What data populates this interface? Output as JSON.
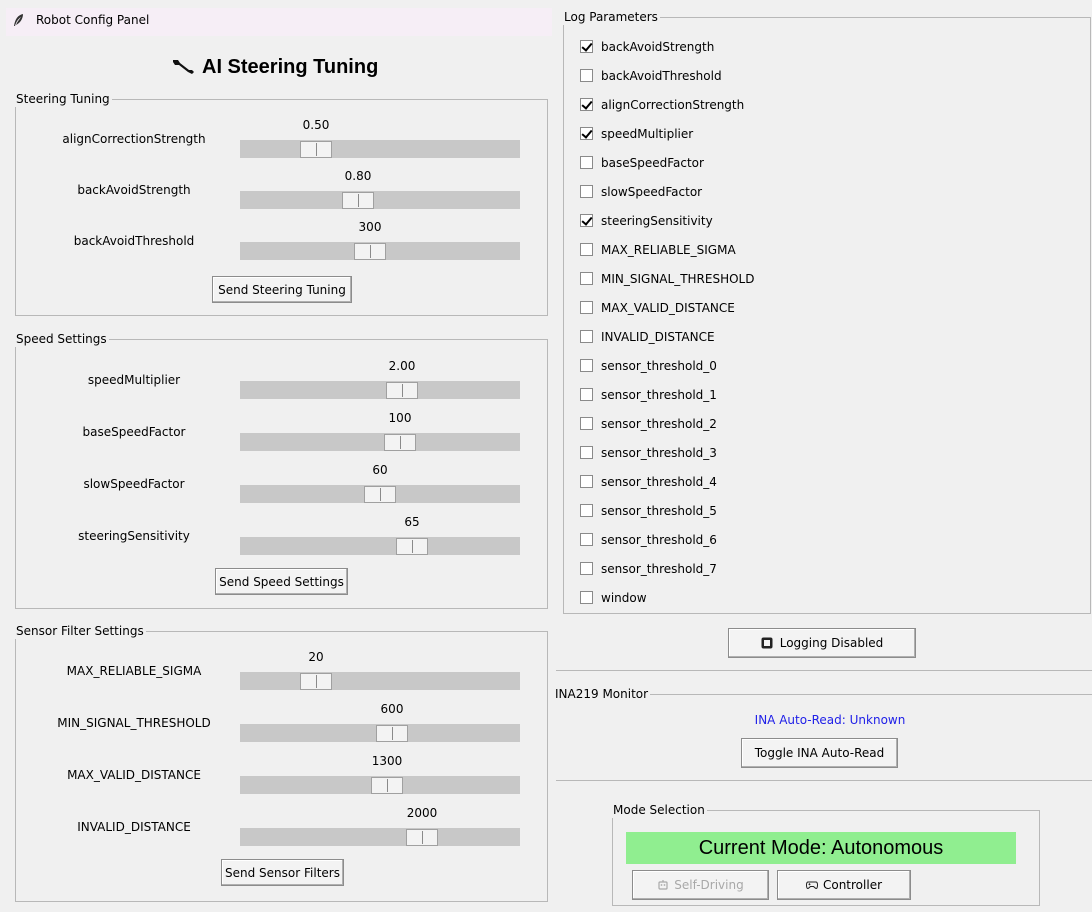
{
  "window": {
    "title": "Robot Config Panel"
  },
  "heading": "AI Steering Tuning",
  "steering": {
    "title": "Steering Tuning",
    "sliders": [
      {
        "label": "alignCorrectionStrength",
        "value": "0.50",
        "position": 0.24
      },
      {
        "label": "backAvoidStrength",
        "value": "0.80",
        "position": 0.41
      },
      {
        "label": "backAvoidThreshold",
        "value": "300",
        "position": 0.46
      }
    ],
    "button": "Send Steering Tuning"
  },
  "speed": {
    "title": "Speed Settings",
    "sliders": [
      {
        "label": "speedMultiplier",
        "value": "2.00",
        "position": 0.59
      },
      {
        "label": "baseSpeedFactor",
        "value": "100",
        "position": 0.58
      },
      {
        "label": "slowSpeedFactor",
        "value": "60",
        "position": 0.5
      },
      {
        "label": "steeringSensitivity",
        "value": "65",
        "position": 0.63
      }
    ],
    "button": "Send Speed Settings"
  },
  "sensor": {
    "title": "Sensor Filter Settings",
    "sliders": [
      {
        "label": "MAX_RELIABLE_SIGMA",
        "value": "20",
        "position": 0.24
      },
      {
        "label": "MIN_SIGNAL_THRESHOLD",
        "value": "600",
        "position": 0.55
      },
      {
        "label": "MAX_VALID_DISTANCE",
        "value": "1300",
        "position": 0.53
      },
      {
        "label": "INVALID_DISTANCE",
        "value": "2000",
        "position": 0.67
      }
    ],
    "button": "Send Sensor Filters"
  },
  "log": {
    "title": "Log Parameters",
    "params": [
      {
        "label": "backAvoidStrength",
        "checked": true
      },
      {
        "label": "backAvoidThreshold",
        "checked": false
      },
      {
        "label": "alignCorrectionStrength",
        "checked": true
      },
      {
        "label": "speedMultiplier",
        "checked": true
      },
      {
        "label": "baseSpeedFactor",
        "checked": false
      },
      {
        "label": "slowSpeedFactor",
        "checked": false
      },
      {
        "label": "steeringSensitivity",
        "checked": true
      },
      {
        "label": "MAX_RELIABLE_SIGMA",
        "checked": false
      },
      {
        "label": "MIN_SIGNAL_THRESHOLD",
        "checked": false
      },
      {
        "label": "MAX_VALID_DISTANCE",
        "checked": false
      },
      {
        "label": "INVALID_DISTANCE",
        "checked": false
      },
      {
        "label": "sensor_threshold_0",
        "checked": false
      },
      {
        "label": "sensor_threshold_1",
        "checked": false
      },
      {
        "label": "sensor_threshold_2",
        "checked": false
      },
      {
        "label": "sensor_threshold_3",
        "checked": false
      },
      {
        "label": "sensor_threshold_4",
        "checked": false
      },
      {
        "label": "sensor_threshold_5",
        "checked": false
      },
      {
        "label": "sensor_threshold_6",
        "checked": false
      },
      {
        "label": "sensor_threshold_7",
        "checked": false
      },
      {
        "label": "window",
        "checked": false
      }
    ],
    "toggle_button": "Logging Disabled"
  },
  "ina": {
    "title": "INA219 Monitor",
    "status": "INA Auto-Read: Unknown",
    "toggle_button": "Toggle INA Auto-Read"
  },
  "mode": {
    "title": "Mode Selection",
    "current": "Current Mode: Autonomous",
    "self_driving_button": "Self-Driving",
    "controller_button": "Controller"
  },
  "colors": {
    "mode_banner": "#90ee90",
    "ina_status": "#2020e8",
    "trough": "#c8c8c8",
    "background": "#f0f0f0"
  },
  "icons": {
    "title": "feather-icon",
    "heading": "wrench-icon",
    "logging": "stop-square-icon",
    "self_driving": "robot-icon",
    "controller": "gamepad-icon"
  }
}
